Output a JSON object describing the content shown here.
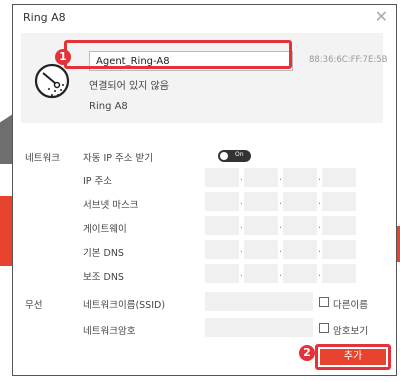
{
  "window": {
    "title": "Ring A8"
  },
  "device": {
    "name_value": "Agent_Ring-A8",
    "mac": "88:36:6C:FF:7E:5B",
    "status": "연결되어 있지 않음",
    "model": "Ring A8"
  },
  "network": {
    "section_label": "네트워크",
    "auto_ip_label": "자동 IP 주소 받기",
    "auto_ip_toggle": {
      "text": "On"
    },
    "fields": [
      {
        "label": "IP 주소"
      },
      {
        "label": "서브넷 마스크"
      },
      {
        "label": "게이트웨이"
      },
      {
        "label": "기본 DNS"
      },
      {
        "label": "보조 DNS"
      }
    ],
    "separator": "."
  },
  "wireless": {
    "section_label": "무선",
    "ssid_label": "네트워크이름(SSID)",
    "ssid_checkbox_label": "다른이름",
    "password_label": "네트워크암호",
    "password_checkbox_label": "암호보기"
  },
  "actions": {
    "add_label": "추가"
  },
  "annotations": {
    "marker1": "1",
    "marker2": "2"
  },
  "colors": {
    "accent": "#e8432f",
    "highlight": "#e5313a",
    "toggle": "#333333"
  }
}
